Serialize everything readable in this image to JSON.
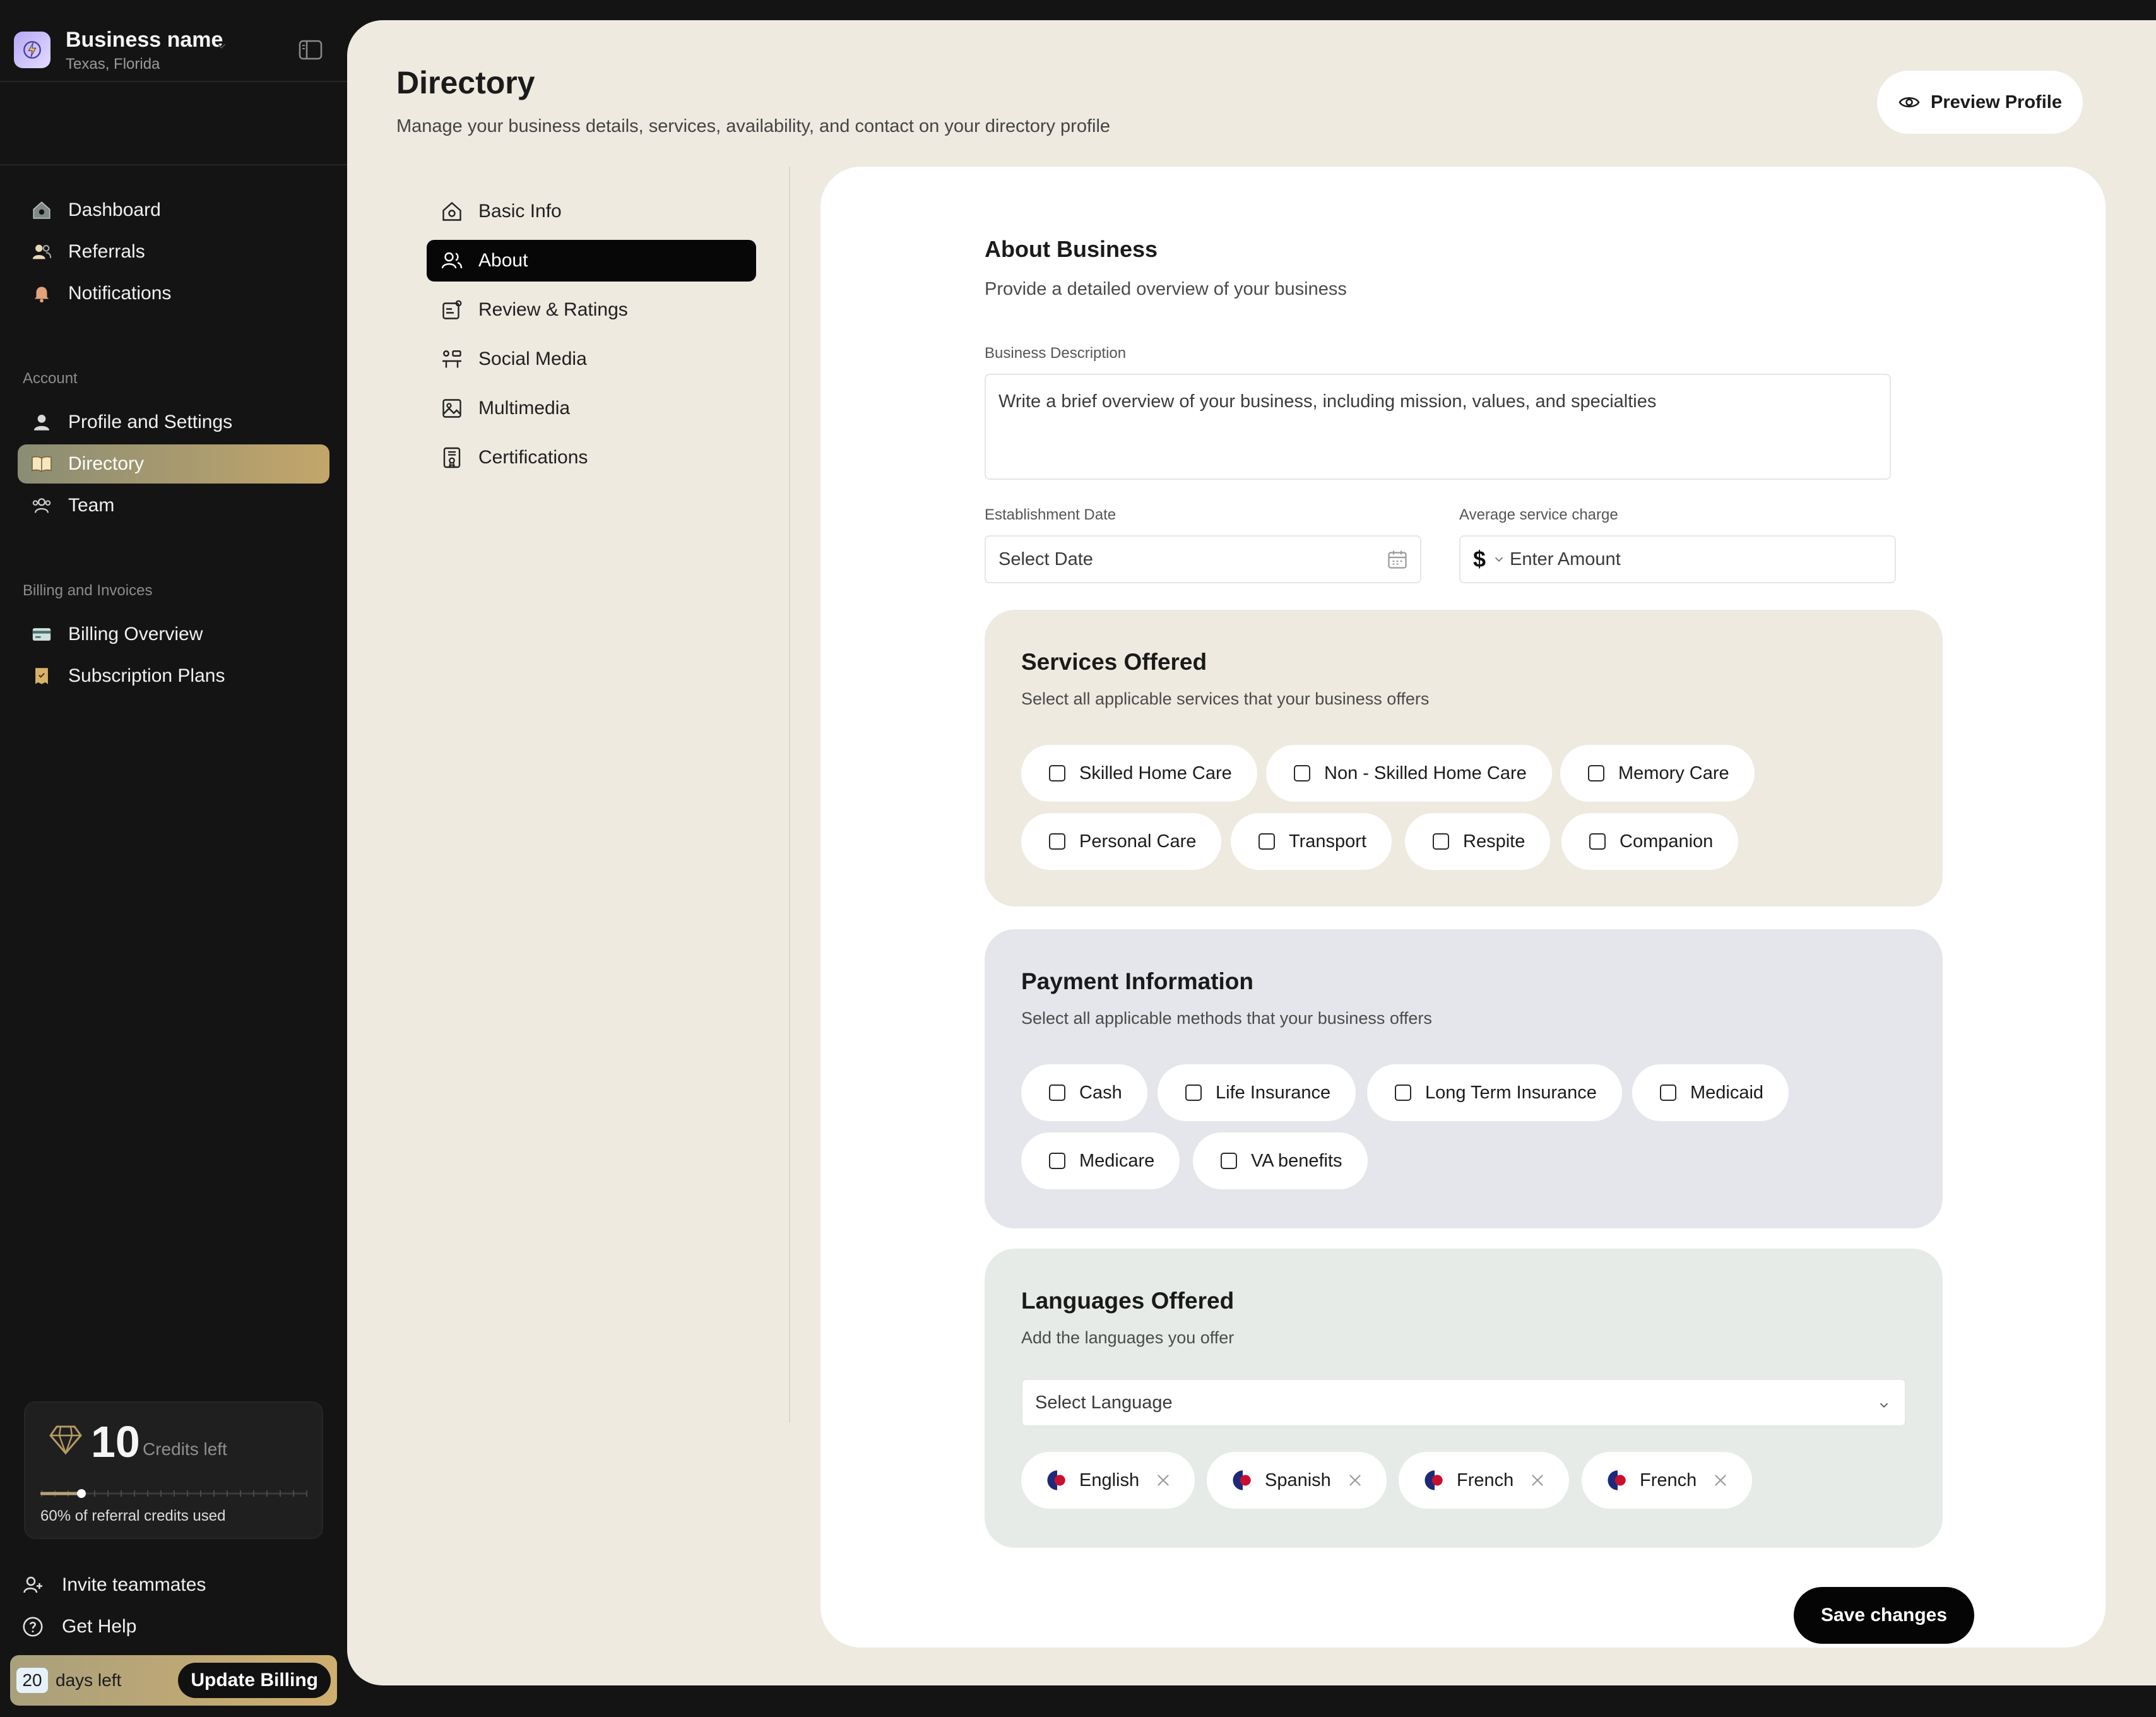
{
  "business": {
    "name": "Business name",
    "location": "Texas, Florida"
  },
  "nav": {
    "main": [
      {
        "label": "Dashboard",
        "icon": "home-icon"
      },
      {
        "label": "Referrals",
        "icon": "users-icon"
      },
      {
        "label": "Notifications",
        "icon": "bell-icon"
      }
    ],
    "account_label": "Account",
    "account": [
      {
        "label": "Profile and Settings",
        "icon": "user-icon"
      },
      {
        "label": "Directory",
        "icon": "book-icon"
      },
      {
        "label": "Team",
        "icon": "team-icon"
      }
    ],
    "billing_label": "Billing and Invoices",
    "billing": [
      {
        "label": "Billing Overview",
        "icon": "credit-card-icon"
      },
      {
        "label": "Subscription Plans",
        "icon": "receipt-icon"
      }
    ]
  },
  "credits": {
    "count": "10",
    "label": "Credits left",
    "caption": "60% of referral credits used",
    "used_fraction": 0.6
  },
  "footer": {
    "invite": "Invite teammates",
    "help": "Get Help"
  },
  "billing_bar": {
    "days": "20",
    "days_label": "days left",
    "button": "Update Billing"
  },
  "page": {
    "title": "Directory",
    "subtitle": "Manage your business details, services, availability, and contact on your directory profile",
    "preview_button": "Preview Profile"
  },
  "subnav": [
    {
      "label": "Basic Info",
      "icon": "house-icon"
    },
    {
      "label": "About",
      "icon": "people-icon"
    },
    {
      "label": "Review & Ratings",
      "icon": "review-icon"
    },
    {
      "label": "Social Media",
      "icon": "share-icon"
    },
    {
      "label": "Multimedia",
      "icon": "image-icon"
    },
    {
      "label": "Certifications",
      "icon": "certificate-icon"
    }
  ],
  "about": {
    "title": "About Business",
    "subtitle": "Provide a detailed overview of your business",
    "description_label": "Business  Description",
    "description_placeholder": "Write a brief overview of your business, including mission, values, and specialties",
    "date_label": "Establishment Date",
    "date_placeholder": "Select Date",
    "charge_label": "Average service charge",
    "currency": "$",
    "charge_placeholder": "Enter Amount"
  },
  "services": {
    "title": "Services Offered",
    "subtitle": "Select all applicable services that your business offers",
    "items": [
      "Skilled Home Care",
      "Non - Skilled Home Care",
      "Memory Care",
      "Personal Care",
      "Transport",
      "Respite",
      "Companion"
    ]
  },
  "payment": {
    "title": "Payment Information",
    "subtitle": "Select all applicable methods that your business offers",
    "items": [
      "Cash",
      "Life Insurance",
      "Long Term Insurance",
      "Medicaid",
      "Medicare",
      "VA benefits"
    ]
  },
  "languages": {
    "title": "Languages Offered",
    "subtitle": "Add the languages you offer",
    "placeholder": "Select Language",
    "items": [
      "English",
      "Spanish",
      "French",
      "French"
    ]
  },
  "save_button": "Save changes",
  "colors": {
    "accent": "#c3a66a",
    "panel_services": "#eeeadf",
    "panel_payment": "#e5e6eb",
    "panel_languages": "#e6ebe7"
  }
}
